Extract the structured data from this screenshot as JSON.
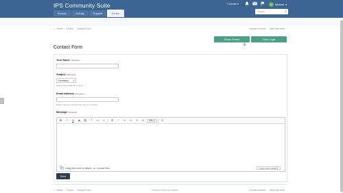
{
  "header": {
    "brand": "IPS Community Suite",
    "nav": [
      "Browse",
      "Activity",
      "Support",
      "Forms"
    ],
    "active_nav": "Forms",
    "create_label": "Create",
    "user_initials": "M",
    "user_name": "Michael",
    "search_placeholder": "Search"
  },
  "breadcrumb": {
    "home": "Home",
    "forms": "Forms",
    "current": "Contact Form"
  },
  "top_links": {
    "unread": "Unread content",
    "mark_read": "Mark site read"
  },
  "actions": {
    "show_forms": "Show Forms",
    "view_logs": "View Logs"
  },
  "form": {
    "title": "Contact Form",
    "required_text": "Required",
    "name_label": "Your Name",
    "subject_label": "Subject",
    "subject_value": "Feedback",
    "subject_hint": "Please select what this is about",
    "email_label": "Email Address",
    "email_hint": "Please enter an email we can reply to if required",
    "message_label": "Message",
    "attach_text": "Drag files here to attach, or",
    "attach_link": "choose files...",
    "insert_label": "Insert other media",
    "send_label": "Send"
  },
  "toolbar": {
    "items": [
      "B",
      "I",
      "U",
      "S",
      "⛓",
      "❝",
      "<>",
      "☺",
      "☰",
      "⋮",
      "≡",
      "≡",
      "≡",
      "A"
    ],
    "size_label": "Size",
    "source": "⎘"
  },
  "footer": {
    "powered_by": "Platform Forms by Invision"
  },
  "side_tab": "<",
  "colors": {
    "header": "#3d6594",
    "accent_green": "#4aa184",
    "send": "#2c3e50",
    "required": "#c0392b"
  }
}
